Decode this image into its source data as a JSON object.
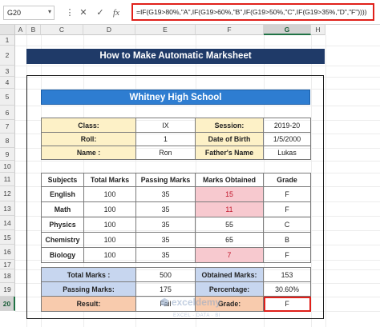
{
  "name_box": "G20",
  "formula_bar": {
    "cancel": "✕",
    "enter": "✓",
    "fx": "fx",
    "formula": "=IF(G19>80%,\"A\",IF(G19>60%,\"B\",IF(G19>50%,\"C\",IF(G19>35%,\"D\",\"F\"))))"
  },
  "columns": [
    "A",
    "B",
    "C",
    "D",
    "E",
    "F",
    "G",
    "H"
  ],
  "selected_column": "G",
  "rows": [
    "1",
    "2",
    "3",
    "4",
    "5",
    "6",
    "7",
    "8",
    "9",
    "10",
    "11",
    "12",
    "13",
    "14",
    "15",
    "16",
    "17",
    "18",
    "19",
    "20"
  ],
  "selected_row": "20",
  "title": "How to Make Automatic Marksheet",
  "school": "Whitney High School",
  "info": {
    "class_label": "Class:",
    "class_value": "IX",
    "session_label": "Session:",
    "session_value": "2019-20",
    "roll_label": "Roll:",
    "roll_value": "1",
    "dob_label": "Date of Birth",
    "dob_value": "1/5/2000",
    "name_label": "Name :",
    "name_value": "Ron",
    "father_label": "Father's Name",
    "father_value": "Lukas"
  },
  "marks_table": {
    "headers": [
      "Subjects",
      "Total Marks",
      "Passing Marks",
      "Marks Obtained",
      "Grade"
    ],
    "rows": [
      {
        "subject": "English",
        "total": "100",
        "passing": "35",
        "obtained": "15",
        "grade": "F",
        "fail": true
      },
      {
        "subject": "Math",
        "total": "100",
        "passing": "35",
        "obtained": "11",
        "grade": "F",
        "fail": true
      },
      {
        "subject": "Physics",
        "total": "100",
        "passing": "35",
        "obtained": "55",
        "grade": "C",
        "fail": false
      },
      {
        "subject": "Chemistry",
        "total": "100",
        "passing": "35",
        "obtained": "65",
        "grade": "B",
        "fail": false
      },
      {
        "subject": "Biology",
        "total": "100",
        "passing": "35",
        "obtained": "7",
        "grade": "F",
        "fail": true
      }
    ]
  },
  "summary": {
    "total_label": "Total Marks :",
    "total_value": "500",
    "obtained_label": "Obtained Marks:",
    "obtained_value": "153",
    "passing_label": "Passing Marks:",
    "passing_value": "175",
    "percentage_label": "Percentage:",
    "percentage_value": "30.60%",
    "result_label": "Result:",
    "result_value": "Fail",
    "grade_label": "Grade:",
    "grade_value": "F"
  },
  "watermark": {
    "brand": "exceldemy",
    "tagline": "EXCEL · DATA · BI"
  },
  "colors": {
    "header_navy": "#1f3a68",
    "school_blue": "#2e7dd1",
    "info_yellow": "#fdf1c7",
    "fail_pink": "#f7c9cf",
    "summary_blue": "#c7d6ef",
    "result_orange": "#f8cbad",
    "selection_red": "#e0201a"
  }
}
